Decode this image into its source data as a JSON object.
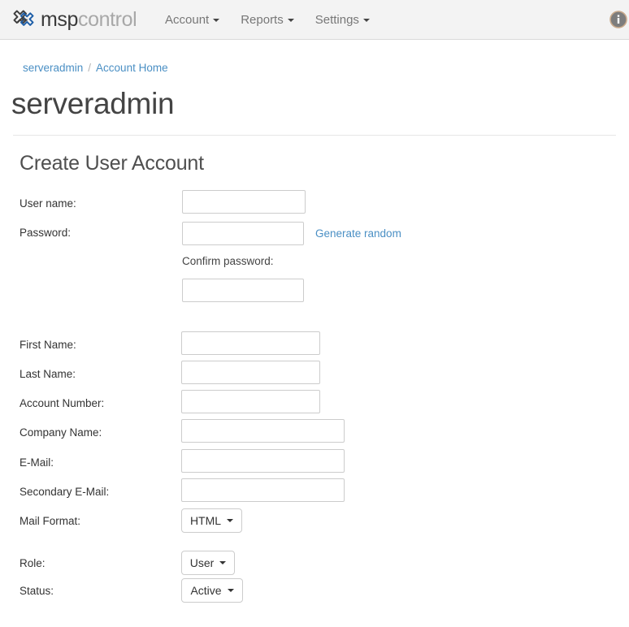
{
  "navbar": {
    "brand": {
      "primary": "msp",
      "secondary": "control",
      "logo_icon": "mspcontrol-logo-icon"
    },
    "items": [
      {
        "label": "Account",
        "icon": "chevron-down-icon"
      },
      {
        "label": "Reports",
        "icon": "chevron-down-icon"
      },
      {
        "label": "Settings",
        "icon": "chevron-down-icon"
      }
    ],
    "info_icon": "info-circle-icon"
  },
  "breadcrumb": {
    "root": "serveradmin",
    "separator": "/",
    "current": "Account Home"
  },
  "page": {
    "title": "serveradmin",
    "section_heading": "Create User Account"
  },
  "form": {
    "username": {
      "label": "User name:",
      "value": "",
      "placeholder": ""
    },
    "password": {
      "label": "Password:",
      "value": "",
      "placeholder": ""
    },
    "generate_random": {
      "label": "Generate random"
    },
    "confirm_password": {
      "label": "Confirm password:",
      "value": "",
      "placeholder": ""
    },
    "first_name": {
      "label": "First Name:",
      "value": "",
      "placeholder": ""
    },
    "last_name": {
      "label": "Last Name:",
      "value": "",
      "placeholder": ""
    },
    "account_number": {
      "label": "Account Number:",
      "value": "",
      "placeholder": ""
    },
    "company_name": {
      "label": "Company Name:",
      "value": "",
      "placeholder": ""
    },
    "email": {
      "label": "E-Mail:",
      "value": "",
      "placeholder": ""
    },
    "secondary_email": {
      "label": "Secondary E-Mail:",
      "value": "",
      "placeholder": ""
    },
    "mail_format": {
      "label": "Mail Format:",
      "selected": "HTML",
      "icon": "chevron-down-icon"
    },
    "role": {
      "label": "Role:",
      "selected": "User",
      "icon": "chevron-down-icon"
    },
    "status": {
      "label": "Status:",
      "selected": "Active",
      "icon": "chevron-down-icon"
    }
  },
  "colors": {
    "link": "#4a8fc4",
    "navbar_bg": "#f3f3f3",
    "brand_primary": "#3a3a3a",
    "brand_secondary": "#a8a8a8",
    "border": "#cccccc"
  }
}
